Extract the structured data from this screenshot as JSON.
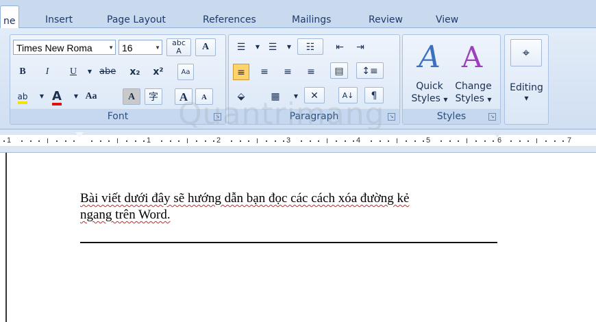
{
  "tabs": [
    {
      "label": "ne",
      "active": true
    },
    {
      "label": "Insert"
    },
    {
      "label": "Page Layout"
    },
    {
      "label": "References"
    },
    {
      "label": "Mailings"
    },
    {
      "label": "Review"
    },
    {
      "label": "View"
    }
  ],
  "font_group": {
    "font_name": "Times New Roma",
    "font_size": "16",
    "label": "Font",
    "bold": "B",
    "italic": "I",
    "underline": "U",
    "strike": "abe",
    "subscript": "x₂",
    "superscript": "x²",
    "font_color": "A",
    "change_case": "Aa",
    "char_shading": "A",
    "enclose": "字",
    "grow": "A",
    "shrink": "A"
  },
  "paragraph_group": {
    "label": "Paragraph",
    "sort": "A↓",
    "pilcrow": "¶"
  },
  "styles_group": {
    "label": "Styles",
    "quick_styles": "Quick",
    "quick_styles_2": "Styles",
    "change_styles": "Change",
    "change_styles_2": "Styles"
  },
  "editing_group": {
    "label": "Editing"
  },
  "ruler": {
    "numbers": [
      "1",
      "1",
      "2",
      "3",
      "4",
      "5",
      "6",
      "7"
    ]
  },
  "document": {
    "line1": "Bài viết dưới đây sẽ hướng dẫn bạn đọc các cách xóa đường kẻ",
    "line2": "ngang trên Word."
  },
  "watermark": "Quantrimang",
  "colors": {
    "accent": "#ffd36a",
    "ribbon": "#dbe7f6",
    "font_red": "#e01010"
  }
}
